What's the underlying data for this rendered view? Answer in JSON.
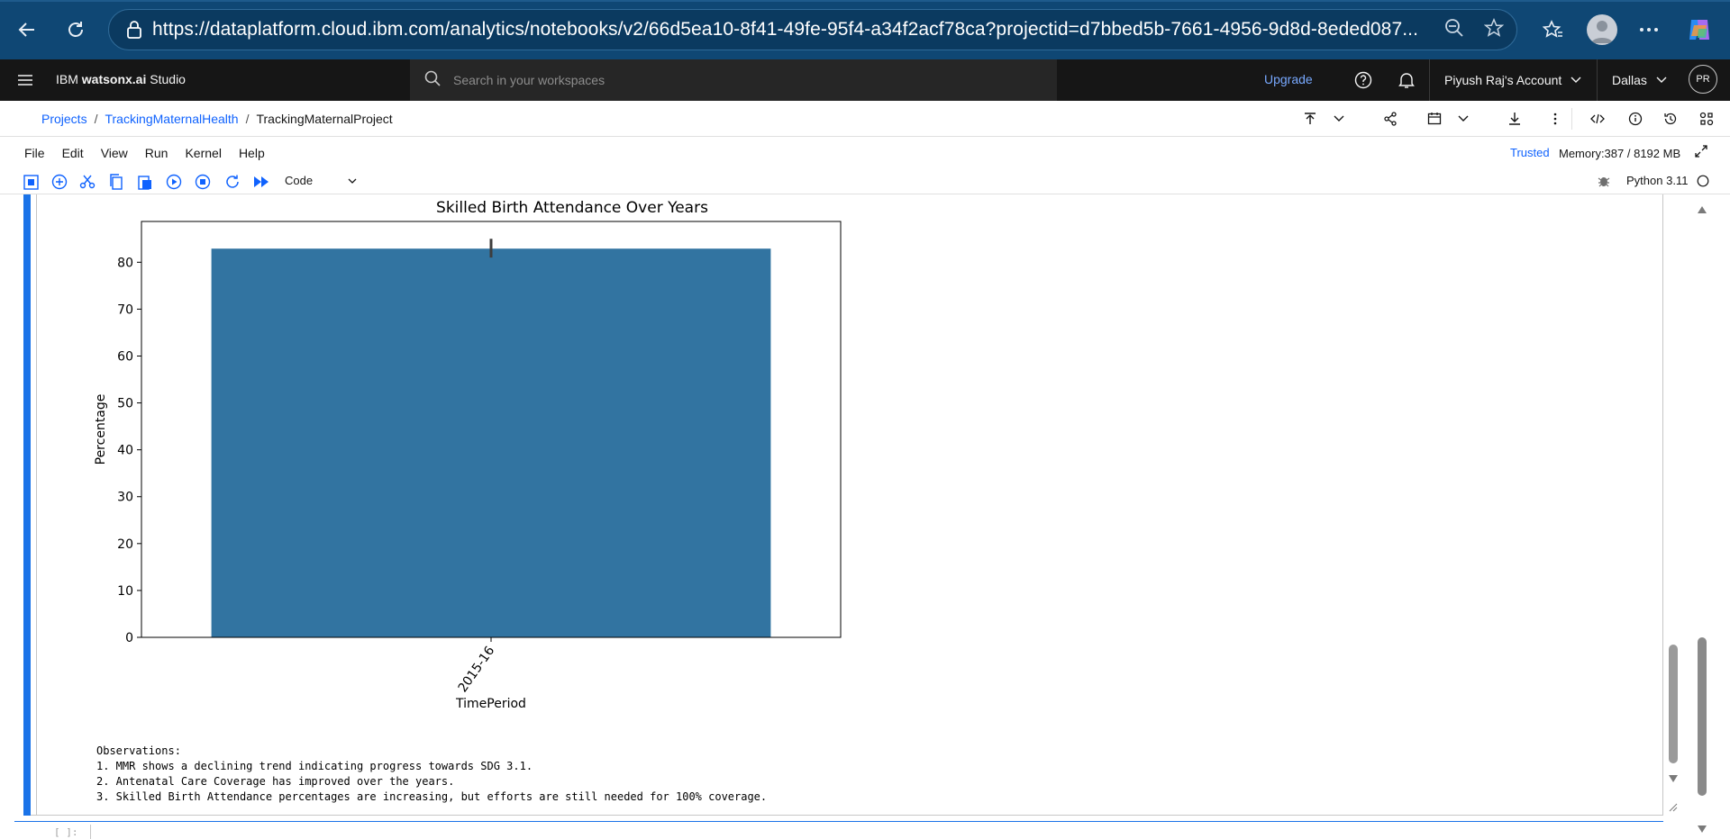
{
  "browser": {
    "url": "https://dataplatform.cloud.ibm.com/analytics/notebooks/v2/66d5ea10-8f41-49fe-95f4-a34f2acf78ca?projectid=d7bbed5b-7661-4956-9d8d-8eded087..."
  },
  "header": {
    "brand_prefix": "IBM ",
    "brand_name": "watsonx.ai",
    "brand_suffix": " Studio",
    "search_placeholder": "Search in your workspaces",
    "upgrade": "Upgrade",
    "account": "Piyush Raj's Account",
    "region": "Dallas",
    "avatar": "PR"
  },
  "breadcrumb": {
    "projects": "Projects",
    "project": "TrackingMaternalHealth",
    "notebook": "TrackingMaternalProject",
    "separator": "/"
  },
  "menu": {
    "items": [
      "File",
      "Edit",
      "View",
      "Run",
      "Kernel",
      "Help"
    ],
    "trusted": "Trusted",
    "memory": "Memory:387 / 8192 MB"
  },
  "toolbar": {
    "cell_type": "Code",
    "kernel": "Python 3.11"
  },
  "cell": {
    "prompt": "[ ]:",
    "observations": [
      "Observations:",
      "1. MMR shows a declining trend indicating progress towards SDG 3.1.",
      "2. Antenatal Care Coverage has improved over the years.",
      "3. Skilled Birth Attendance percentages are increasing, but efforts are still needed for 100% coverage."
    ]
  },
  "chart_data": {
    "type": "bar",
    "title": "Skilled Birth Attendance Over Years",
    "xlabel": "TimePeriod",
    "ylabel": "Percentage",
    "categories": [
      "2015-16"
    ],
    "values": [
      82.9
    ],
    "error_bar": [
      81.0,
      85.0
    ],
    "ylim": [
      0,
      88.7
    ],
    "yticks": [
      0,
      10,
      20,
      30,
      40,
      50,
      60,
      70,
      80
    ],
    "bar_color": "#3274a1",
    "xtick_rotation": -55
  },
  "colors": {
    "browser_bar": "#0f4774",
    "ibm_header": "#161616",
    "link": "#0f62fe",
    "cell_accent": "#1a73e8"
  }
}
